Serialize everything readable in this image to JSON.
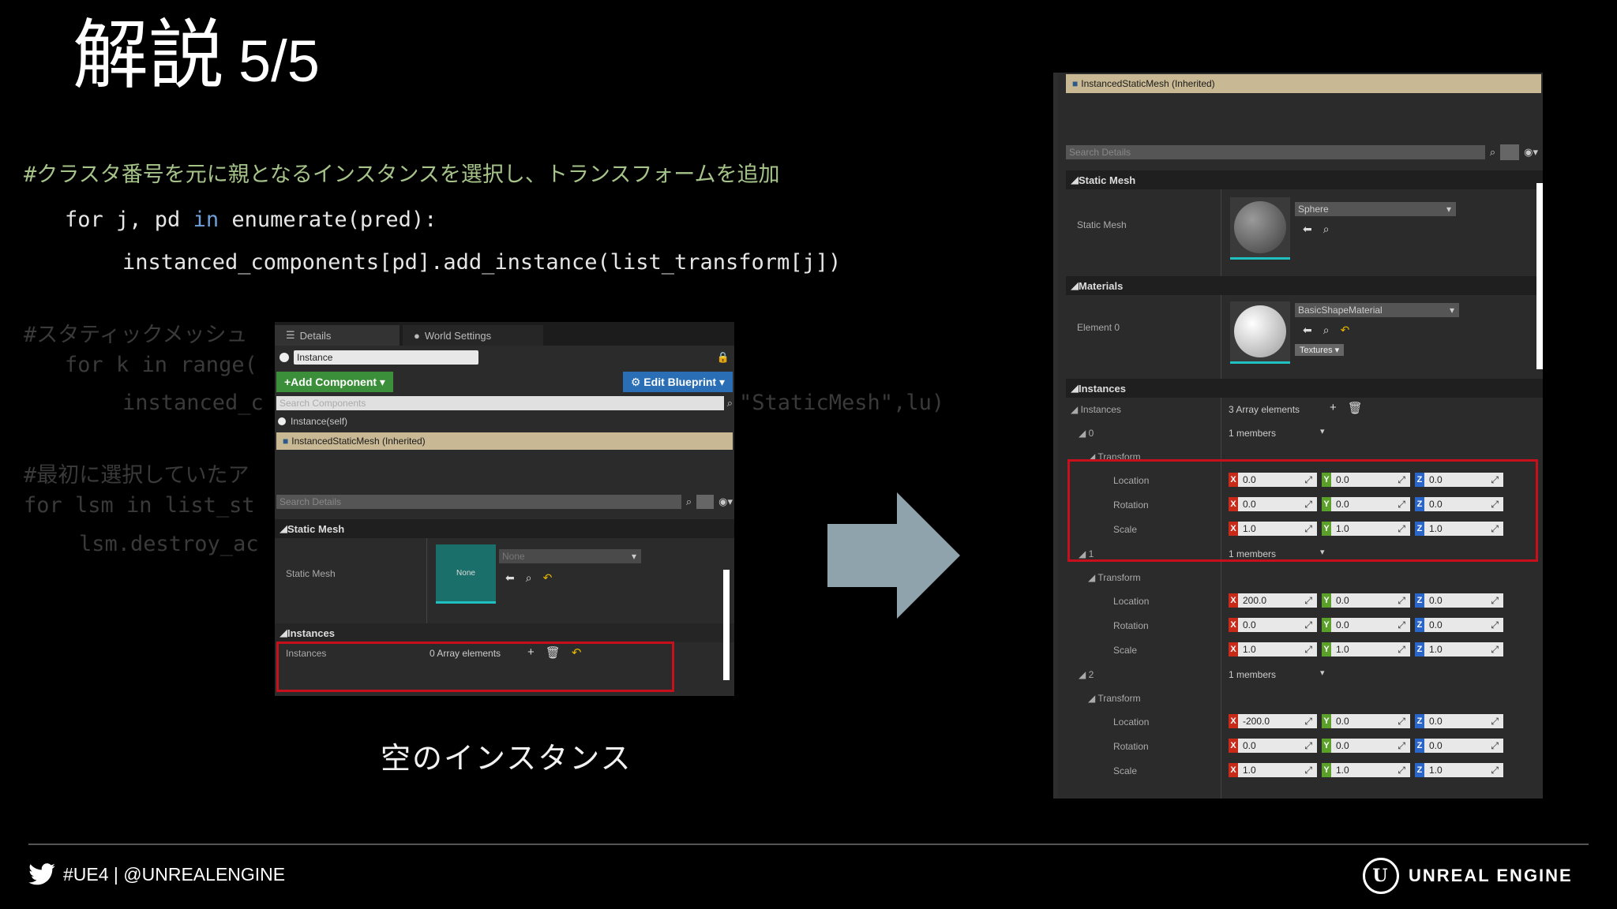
{
  "slide": {
    "title": "解説",
    "page": "5/5",
    "caption": "空のインスタンス",
    "footer_left": "#UE4 | @UNREALENGINE",
    "footer_right": "UNREAL ENGINE",
    "logo_letter": "U"
  },
  "code": {
    "comment1": "#クラスタ番号を元に親となるインスタンスを選択し、トランスフォームを追加",
    "line2_a": "for j, pd ",
    "line2_kw": "in",
    "line2_b": " enumerate(pred):",
    "line3": "instanced_components[pd].add_instance(list_transform[j])",
    "comment2": "#スタティックメッシュ",
    "line5": "for k in range(",
    "line6": "instanced_c",
    "line6_tail": "\"StaticMesh\",lu)",
    "comment3": "#最初に選択していたア",
    "line8": "for lsm in list_st",
    "line9": "lsm.destroy_ac"
  },
  "left_panel": {
    "tab_details": "Details",
    "tab_world": "World Settings",
    "name_value": "Instance",
    "add_component": "+Add Component ▾",
    "edit_blueprint": "⚙ Edit Blueprint ▾",
    "search_components": "Search Components",
    "item_self": "Instance(self)",
    "item_ism": "InstancedStaticMesh (Inherited)",
    "search_details": "Search Details",
    "section_static_mesh": "Static Mesh",
    "label_static_mesh": "Static Mesh",
    "thumb_text": "None",
    "mesh_value": "None",
    "section_instances": "Instances",
    "label_instances": "Instances",
    "instances_value": "0 Array elements"
  },
  "right_panel": {
    "header": "InstancedStaticMesh (Inherited)",
    "search_details": "Search Details",
    "section_static_mesh": "Static Mesh",
    "label_static_mesh": "Static Mesh",
    "mesh_value": "Sphere",
    "section_materials": "Materials",
    "label_element": "Element 0",
    "material_value": "BasicShapeMaterial",
    "textures_btn": "Textures ▾",
    "section_instances": "Instances",
    "label_instances": "Instances",
    "instances_value": "3 Array elements",
    "transform_label": "Transform",
    "labels": {
      "location": "Location",
      "rotation": "Rotation",
      "scale": "Scale",
      "members": "1 members"
    },
    "instances": [
      {
        "index": "0",
        "loc": [
          "0.0",
          "0.0",
          "0.0"
        ],
        "rot": [
          "0.0",
          "0.0",
          "0.0"
        ],
        "scale": [
          "1.0",
          "1.0",
          "1.0"
        ]
      },
      {
        "index": "1",
        "loc": [
          "200.0",
          "0.0",
          "0.0"
        ],
        "rot": [
          "0.0",
          "0.0",
          "0.0"
        ],
        "scale": [
          "1.0",
          "1.0",
          "1.0"
        ]
      },
      {
        "index": "2",
        "loc": [
          "-200.0",
          "0.0",
          "0.0"
        ],
        "rot": [
          "0.0",
          "0.0",
          "0.0"
        ],
        "scale": [
          "1.0",
          "1.0",
          "1.0"
        ]
      }
    ]
  },
  "colors": {
    "arrow": "#8fa3ad",
    "highlight_box": "#c8101c",
    "comment": "#a6c48a",
    "keyword": "#6f9fd8"
  }
}
